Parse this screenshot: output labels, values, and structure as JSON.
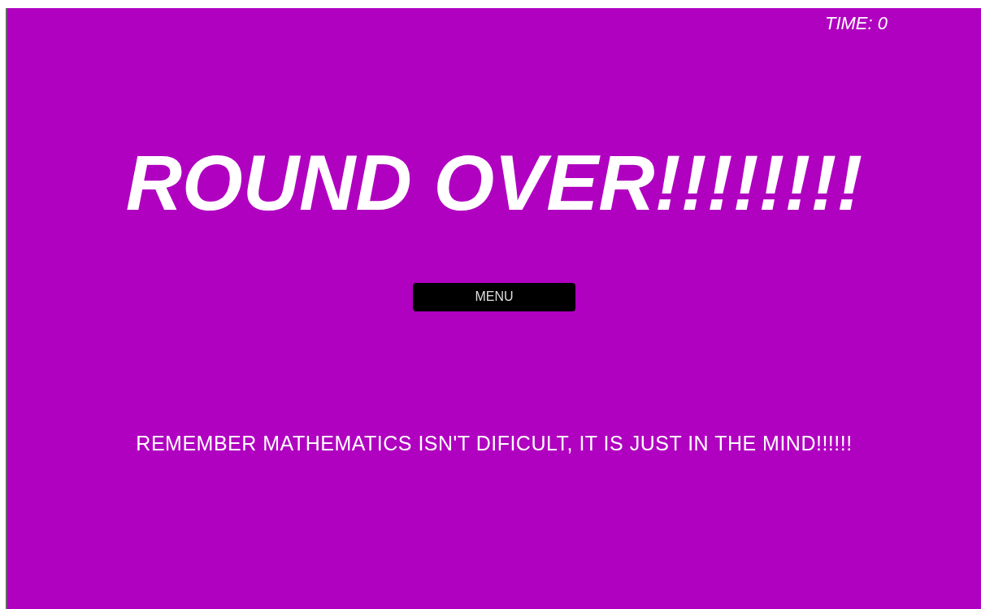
{
  "timer": "TIME: 0",
  "title": "ROUND OVER!!!!!!!!",
  "menu_button": "MENU",
  "message": "REMEMBER MATHEMATICS ISN'T DIFICULT, IT IS JUST IN THE MIND!!!!!!"
}
